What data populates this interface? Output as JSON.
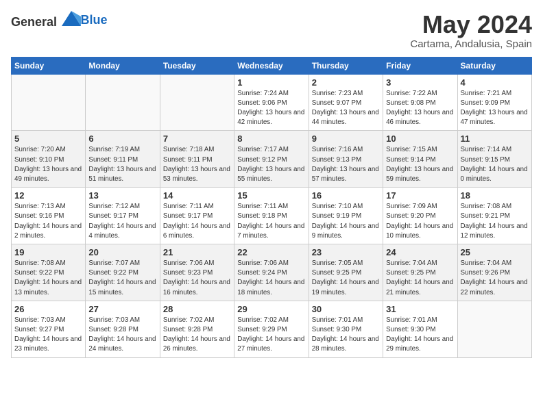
{
  "logo": {
    "general": "General",
    "blue": "Blue"
  },
  "title": "May 2024",
  "location": "Cartama, Andalusia, Spain",
  "weekdays": [
    "Sunday",
    "Monday",
    "Tuesday",
    "Wednesday",
    "Thursday",
    "Friday",
    "Saturday"
  ],
  "weeks": [
    [
      {
        "day": "",
        "info": ""
      },
      {
        "day": "",
        "info": ""
      },
      {
        "day": "",
        "info": ""
      },
      {
        "day": "1",
        "info": "Sunrise: 7:24 AM\nSunset: 9:06 PM\nDaylight: 13 hours\nand 42 minutes."
      },
      {
        "day": "2",
        "info": "Sunrise: 7:23 AM\nSunset: 9:07 PM\nDaylight: 13 hours\nand 44 minutes."
      },
      {
        "day": "3",
        "info": "Sunrise: 7:22 AM\nSunset: 9:08 PM\nDaylight: 13 hours\nand 46 minutes."
      },
      {
        "day": "4",
        "info": "Sunrise: 7:21 AM\nSunset: 9:09 PM\nDaylight: 13 hours\nand 47 minutes."
      }
    ],
    [
      {
        "day": "5",
        "info": "Sunrise: 7:20 AM\nSunset: 9:10 PM\nDaylight: 13 hours\nand 49 minutes."
      },
      {
        "day": "6",
        "info": "Sunrise: 7:19 AM\nSunset: 9:11 PM\nDaylight: 13 hours\nand 51 minutes."
      },
      {
        "day": "7",
        "info": "Sunrise: 7:18 AM\nSunset: 9:11 PM\nDaylight: 13 hours\nand 53 minutes."
      },
      {
        "day": "8",
        "info": "Sunrise: 7:17 AM\nSunset: 9:12 PM\nDaylight: 13 hours\nand 55 minutes."
      },
      {
        "day": "9",
        "info": "Sunrise: 7:16 AM\nSunset: 9:13 PM\nDaylight: 13 hours\nand 57 minutes."
      },
      {
        "day": "10",
        "info": "Sunrise: 7:15 AM\nSunset: 9:14 PM\nDaylight: 13 hours\nand 59 minutes."
      },
      {
        "day": "11",
        "info": "Sunrise: 7:14 AM\nSunset: 9:15 PM\nDaylight: 14 hours\nand 0 minutes."
      }
    ],
    [
      {
        "day": "12",
        "info": "Sunrise: 7:13 AM\nSunset: 9:16 PM\nDaylight: 14 hours\nand 2 minutes."
      },
      {
        "day": "13",
        "info": "Sunrise: 7:12 AM\nSunset: 9:17 PM\nDaylight: 14 hours\nand 4 minutes."
      },
      {
        "day": "14",
        "info": "Sunrise: 7:11 AM\nSunset: 9:17 PM\nDaylight: 14 hours\nand 6 minutes."
      },
      {
        "day": "15",
        "info": "Sunrise: 7:11 AM\nSunset: 9:18 PM\nDaylight: 14 hours\nand 7 minutes."
      },
      {
        "day": "16",
        "info": "Sunrise: 7:10 AM\nSunset: 9:19 PM\nDaylight: 14 hours\nand 9 minutes."
      },
      {
        "day": "17",
        "info": "Sunrise: 7:09 AM\nSunset: 9:20 PM\nDaylight: 14 hours\nand 10 minutes."
      },
      {
        "day": "18",
        "info": "Sunrise: 7:08 AM\nSunset: 9:21 PM\nDaylight: 14 hours\nand 12 minutes."
      }
    ],
    [
      {
        "day": "19",
        "info": "Sunrise: 7:08 AM\nSunset: 9:22 PM\nDaylight: 14 hours\nand 13 minutes."
      },
      {
        "day": "20",
        "info": "Sunrise: 7:07 AM\nSunset: 9:22 PM\nDaylight: 14 hours\nand 15 minutes."
      },
      {
        "day": "21",
        "info": "Sunrise: 7:06 AM\nSunset: 9:23 PM\nDaylight: 14 hours\nand 16 minutes."
      },
      {
        "day": "22",
        "info": "Sunrise: 7:06 AM\nSunset: 9:24 PM\nDaylight: 14 hours\nand 18 minutes."
      },
      {
        "day": "23",
        "info": "Sunrise: 7:05 AM\nSunset: 9:25 PM\nDaylight: 14 hours\nand 19 minutes."
      },
      {
        "day": "24",
        "info": "Sunrise: 7:04 AM\nSunset: 9:25 PM\nDaylight: 14 hours\nand 21 minutes."
      },
      {
        "day": "25",
        "info": "Sunrise: 7:04 AM\nSunset: 9:26 PM\nDaylight: 14 hours\nand 22 minutes."
      }
    ],
    [
      {
        "day": "26",
        "info": "Sunrise: 7:03 AM\nSunset: 9:27 PM\nDaylight: 14 hours\nand 23 minutes."
      },
      {
        "day": "27",
        "info": "Sunrise: 7:03 AM\nSunset: 9:28 PM\nDaylight: 14 hours\nand 24 minutes."
      },
      {
        "day": "28",
        "info": "Sunrise: 7:02 AM\nSunset: 9:28 PM\nDaylight: 14 hours\nand 26 minutes."
      },
      {
        "day": "29",
        "info": "Sunrise: 7:02 AM\nSunset: 9:29 PM\nDaylight: 14 hours\nand 27 minutes."
      },
      {
        "day": "30",
        "info": "Sunrise: 7:01 AM\nSunset: 9:30 PM\nDaylight: 14 hours\nand 28 minutes."
      },
      {
        "day": "31",
        "info": "Sunrise: 7:01 AM\nSunset: 9:30 PM\nDaylight: 14 hours\nand 29 minutes."
      },
      {
        "day": "",
        "info": ""
      }
    ]
  ]
}
